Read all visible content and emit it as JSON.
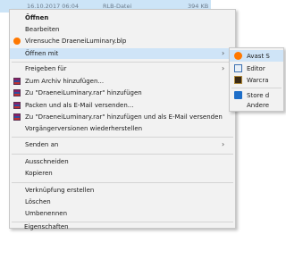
{
  "file_row": {
    "date": "16.10.2017 06:04",
    "type": "RLB-Datei",
    "size": "394 KB"
  },
  "menu": {
    "items": [
      {
        "label": "Öffnen",
        "bold": true
      },
      {
        "label": "Bearbeiten"
      },
      {
        "label": "Virensuche DraeneiLuminary.blp",
        "icon": "avast-icon"
      },
      {
        "label": "Öffnen mit",
        "submenu": true,
        "hover": true
      },
      {
        "label": "Freigeben für",
        "submenu": true
      },
      {
        "label": "Zum Archiv hinzufügen...",
        "icon": "winrar-icon"
      },
      {
        "label": "Zu \"DraeneiLuminary.rar\" hinzufügen",
        "icon": "winrar-icon"
      },
      {
        "label": "Packen und als E-Mail versenden...",
        "icon": "winrar-icon"
      },
      {
        "label": "Zu \"DraeneiLuminary.rar\" hinzufügen und als E-Mail versenden",
        "icon": "winrar-icon"
      },
      {
        "label": "Vorgängerversionen wiederherstellen"
      },
      {
        "label": "Senden an",
        "submenu": true
      },
      {
        "label": "Ausschneiden"
      },
      {
        "label": "Kopieren"
      },
      {
        "label": "Verknüpfung erstellen"
      },
      {
        "label": "Löschen"
      },
      {
        "label": "Umbenennen"
      },
      {
        "label": "Eigenschaften"
      }
    ],
    "arrow_glyph": "›"
  },
  "submenu": {
    "items": [
      {
        "label": "Avast S",
        "icon": "avast-icon"
      },
      {
        "label": "Editor",
        "icon": "notepad-icon"
      },
      {
        "label": "Warcra",
        "icon": "warcraft-icon"
      },
      {
        "label": "Store d",
        "icon": "store-icon"
      },
      {
        "label": "Andere"
      }
    ]
  }
}
